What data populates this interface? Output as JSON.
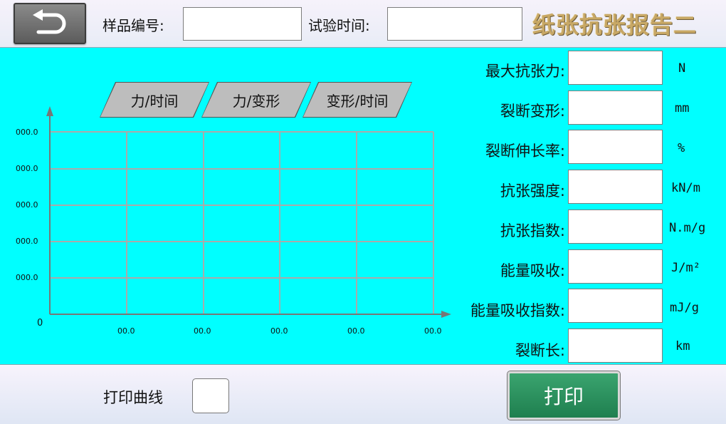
{
  "header": {
    "sample_no_label": "样品编号:",
    "sample_no_value": "",
    "test_time_label": "试验时间:",
    "test_time_value": "",
    "title": "纸张抗张报告二"
  },
  "chart_tabs": [
    "力/时间",
    "力/变形",
    "变形/时间"
  ],
  "chart_data": {
    "type": "line",
    "y_tick_labels": [
      "000.0",
      "000.0",
      "000.0",
      "000.0",
      "000.0"
    ],
    "x_tick_labels": [
      "00.0",
      "00.0",
      "00.0",
      "00.0",
      "00.0"
    ],
    "origin_label": "0",
    "series": [],
    "grid": true
  },
  "results": [
    {
      "label": "最大抗张力:",
      "value": "",
      "unit": "N"
    },
    {
      "label": "裂断变形:",
      "value": "",
      "unit": "mm"
    },
    {
      "label": "裂断伸长率:",
      "value": "",
      "unit": "%"
    },
    {
      "label": "抗张强度:",
      "value": "",
      "unit": "kN/m"
    },
    {
      "label": "抗张指数:",
      "value": "",
      "unit": "N.m/g"
    },
    {
      "label": "能量吸收:",
      "value": "",
      "unit": "J/m²"
    },
    {
      "label": "能量吸收指数:",
      "value": "",
      "unit": "mJ/g"
    },
    {
      "label": "裂断长:",
      "value": "",
      "unit": "km"
    }
  ],
  "footer": {
    "print_curve_label": "打印曲线",
    "print_curve_checked": false,
    "print_button_label": "打印"
  },
  "colors": {
    "panel_bg": "#00ffff",
    "title_gold": "#c8a865",
    "print_green": "#2a9160",
    "back_gray": "#6e6e6e"
  },
  "icons": {
    "back": "return-arrow-icon"
  }
}
